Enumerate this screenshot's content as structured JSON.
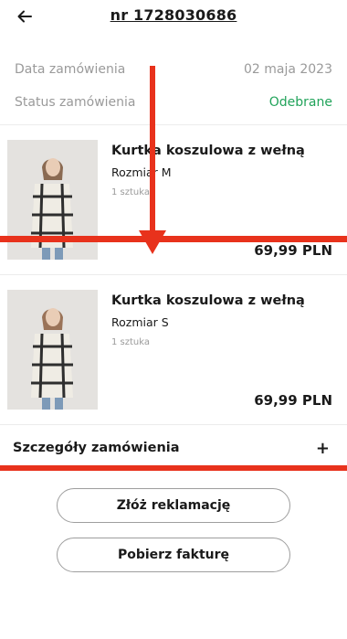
{
  "header": {
    "title": "nr 1728030686",
    "back_icon": "arrow-left-icon"
  },
  "order_meta": {
    "date_label": "Data zamówienia",
    "date_value": "02 maja 2023",
    "status_label": "Status zamówienia",
    "status_value": "Odebrane",
    "status_color": "#21a35a"
  },
  "products": [
    {
      "name": "Kurtka koszulowa z wełną",
      "size": "Rozmiar M",
      "quantity": "1 sztuka",
      "price": "69,99 PLN"
    },
    {
      "name": "Kurtka koszulowa z wełną",
      "size": "Rozmiar S",
      "quantity": "1 sztuka",
      "price": "69,99 PLN"
    }
  ],
  "details": {
    "label": "Szczegóły zamówienia",
    "toggle_icon": "plus-icon"
  },
  "actions": {
    "complaint_label": "Złóż reklamację",
    "invoice_label": "Pobierz fakturę"
  },
  "overlay_color": "#e8321c"
}
